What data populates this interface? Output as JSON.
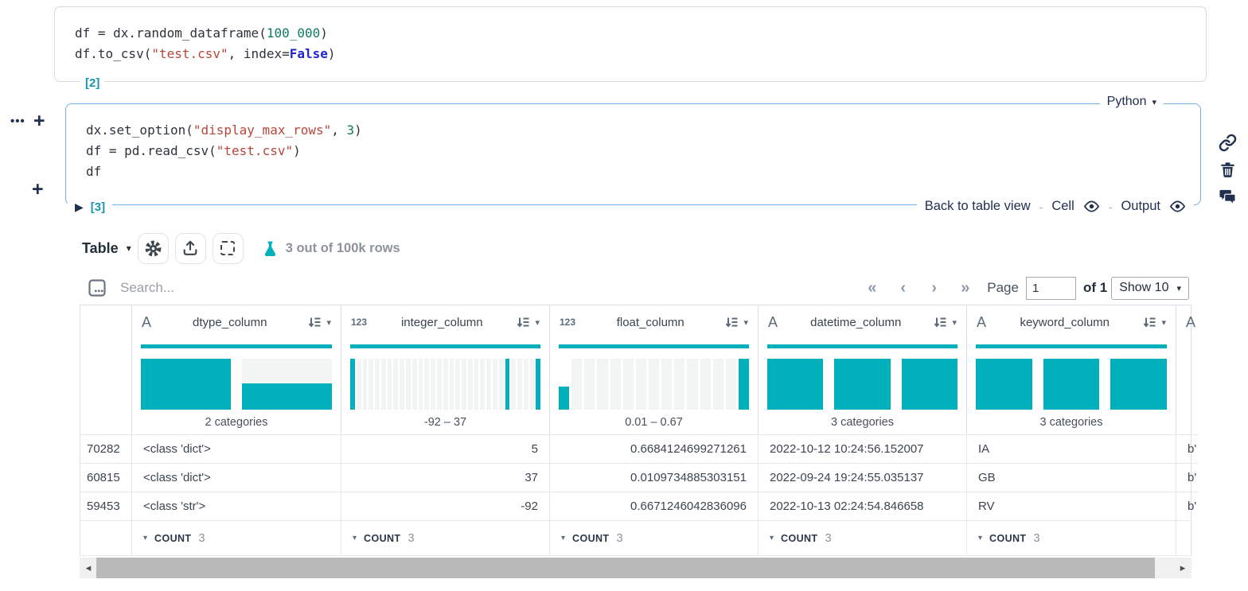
{
  "cell1": {
    "execution_label": "[2]",
    "code": [
      [
        {
          "t": "df = dx.random_dataframe(",
          "c": "plain"
        },
        {
          "t": "100_000",
          "c": "num"
        },
        {
          "t": ")",
          "c": "plain"
        }
      ],
      [
        {
          "t": "df.to_csv(",
          "c": "plain"
        },
        {
          "t": "\"test.csv\"",
          "c": "str"
        },
        {
          "t": ", index=",
          "c": "plain"
        },
        {
          "t": "False",
          "c": "kw"
        },
        {
          "t": ")",
          "c": "plain"
        }
      ]
    ]
  },
  "cell2": {
    "language_label": "Python",
    "execution_label": "[3]",
    "code": [
      [
        {
          "t": "dx.set_option(",
          "c": "plain"
        },
        {
          "t": "\"display_max_rows\"",
          "c": "str"
        },
        {
          "t": ", ",
          "c": "plain"
        },
        {
          "t": "3",
          "c": "num"
        },
        {
          "t": ")",
          "c": "plain"
        }
      ],
      [
        {
          "t": "df = pd.read_csv(",
          "c": "plain"
        },
        {
          "t": "\"test.csv\"",
          "c": "str"
        },
        {
          "t": ")",
          "c": "plain"
        }
      ],
      [
        {
          "t": "df",
          "c": "plain"
        }
      ]
    ],
    "back_link": "Back to table view",
    "dash": "-",
    "cell_toggle_label": "Cell",
    "output_toggle_label": "Output"
  },
  "toolbar": {
    "view_label": "Table",
    "rows_info": "3 out of 100k rows"
  },
  "search": {
    "placeholder": "Search..."
  },
  "pagination": {
    "first": "«",
    "prev": "‹",
    "next": "›",
    "last": "»",
    "page_label": "Page",
    "page_value": "1",
    "of_label": "of 1",
    "show_label": "Show 10"
  },
  "table": {
    "index_values": [
      "70282",
      "60815",
      "59453"
    ],
    "footer": {
      "agg_label": "COUNT",
      "agg_value": "3"
    },
    "columns": [
      {
        "name": "dtype_column",
        "type": "string",
        "viz": "category",
        "bars": [
          100,
          52
        ],
        "summary": "2 categories",
        "align": "left",
        "values": [
          "<class 'dict'>",
          "<class 'dict'>",
          "<class 'str'>"
        ]
      },
      {
        "name": "integer_column",
        "type": "number",
        "viz": "histogram",
        "bins": 31,
        "teal_bins": [
          0,
          25,
          30
        ],
        "summary": "-92 – 37",
        "align": "right",
        "values": [
          "5",
          "37",
          "-92"
        ]
      },
      {
        "name": "float_column",
        "type": "number",
        "viz": "histogram",
        "bins": 15,
        "teal_bins": [
          14
        ],
        "partial_bin": {
          "index": 0,
          "height": 45
        },
        "summary": "0.01 – 0.67",
        "align": "right",
        "values": [
          "0.6684124699271261",
          "0.0109734885303151",
          "0.6671246042836096"
        ]
      },
      {
        "name": "datetime_column",
        "type": "string",
        "viz": "category",
        "bars": [
          100,
          100,
          100
        ],
        "summary": "3 categories",
        "align": "left",
        "values": [
          "2022-10-12 10:24:56.152007",
          "2022-09-24 19:24:55.035137",
          "2022-10-13 02:24:54.846658"
        ]
      },
      {
        "name": "keyword_column",
        "type": "string",
        "viz": "category",
        "bars": [
          100,
          100,
          100
        ],
        "summary": "3 categories",
        "align": "left",
        "values": [
          "IA",
          "GB",
          "RV"
        ]
      },
      {
        "name": "",
        "type": "string",
        "viz": "category",
        "bars": [
          100
        ],
        "summary": "",
        "partial": true,
        "align": "left",
        "values": [
          "b'",
          "b'",
          "b'"
        ]
      }
    ]
  },
  "colors": {
    "teal": "#00b0bd",
    "navy": "#22304f",
    "accent_blue": "#74afe3",
    "exec_teal": "#1b93af"
  }
}
